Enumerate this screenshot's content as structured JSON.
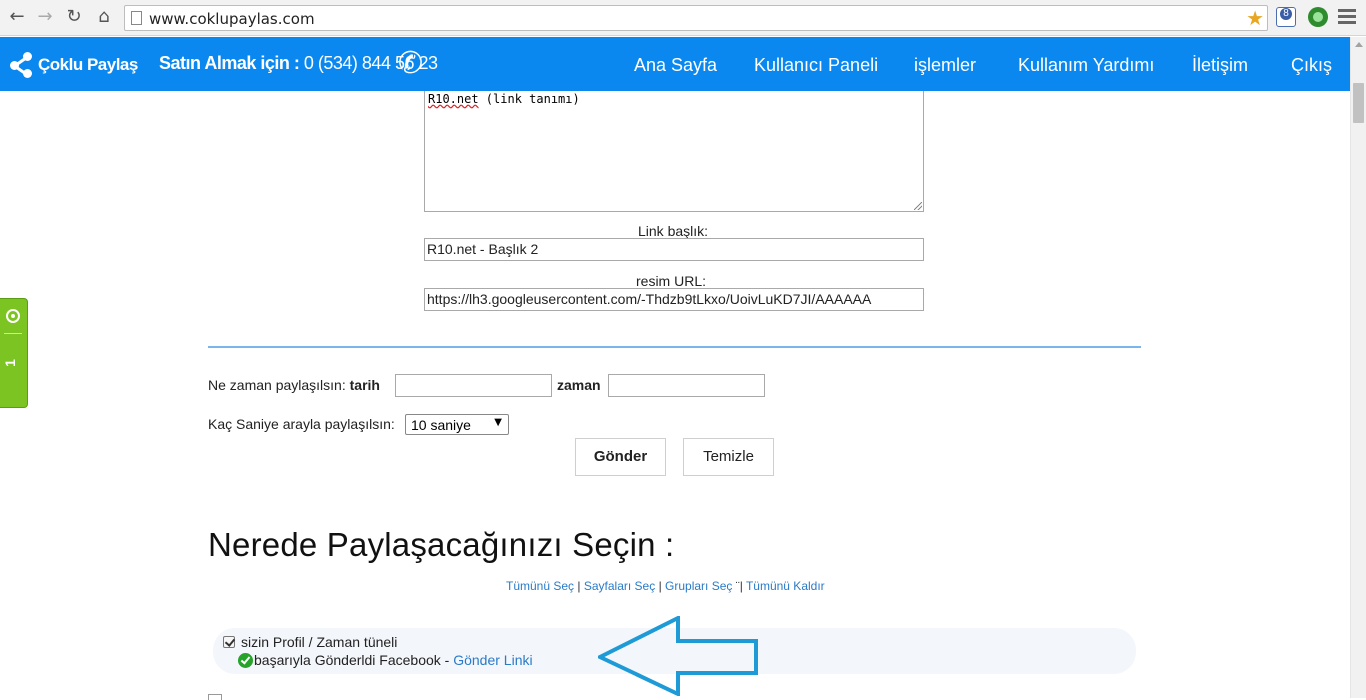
{
  "browser": {
    "url": "www.coklupaylas.com",
    "ext_badge": "8"
  },
  "site": {
    "logo_text": "Çoklu Paylaş",
    "phone_label": "Satın Almak için :",
    "phone_number": "0 (534) 844 56 23",
    "nav": [
      "Ana Sayfa",
      "Kullanıcı Paneli",
      "işlemler",
      "Kullanım Yardımı",
      "İletişim",
      "Çıkış"
    ]
  },
  "side_widget": {
    "number": "1"
  },
  "form": {
    "textarea_prefix": "R10.net",
    "textarea_suffix": " (link tanımı)",
    "link_title_label": "Link başlık:",
    "link_title_value": "R10.net - Başlık 2",
    "image_url_label": "resim URL:",
    "image_url_value": "https://lh3.googleusercontent.com/-Thdzb9tLkxo/UoivLuKD7JI/AAAAAA",
    "when_label": "Ne zaman paylaşılsın:",
    "date_label": "tarih",
    "time_label": "zaman",
    "date_value": "",
    "time_value": "",
    "interval_label": "Kaç Saniye arayla paylaşılsın:",
    "interval_value": "10 saniye",
    "submit_label": "Gönder",
    "clear_label": "Temizle"
  },
  "targets": {
    "heading": "Nerede Paylaşacağınızı Seçin :",
    "links": [
      "Tümünü Seç",
      "Sayfaları Seç",
      "Grupları Seç",
      "Tümünü Kaldır"
    ],
    "profile_label": "sizin Profil / Zaman tüneli",
    "status_text": "başarıyla Gönderldi Facebook -",
    "status_link": "Gönder Linki",
    "profile_checked": true
  },
  "colors": {
    "header_bg": "#0a88f0",
    "link": "#2a7bc8",
    "arrow": "#1e9ad6",
    "success": "#27a32b",
    "side_widget": "#7cc422"
  }
}
